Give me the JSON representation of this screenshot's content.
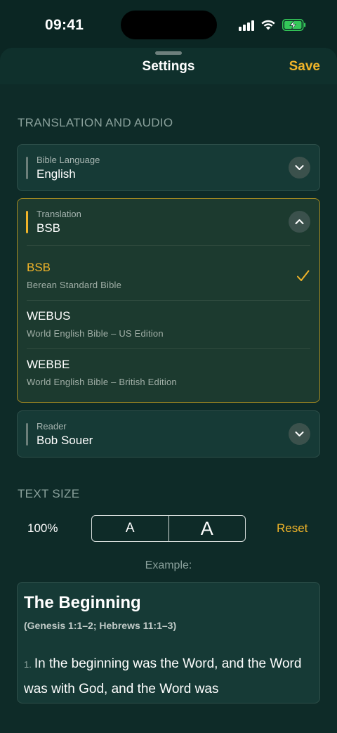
{
  "status": {
    "time": "09:41"
  },
  "header": {
    "title": "Settings",
    "save_label": "Save"
  },
  "sections": {
    "translation_audio": "TRANSLATION AND AUDIO",
    "text_size": "TEXT SIZE"
  },
  "bible_language": {
    "label": "Bible Language",
    "value": "English"
  },
  "translation": {
    "label": "Translation",
    "value": "BSB",
    "options": [
      {
        "code": "BSB",
        "name": "Berean Standard Bible",
        "selected": true
      },
      {
        "code": "WEBUS",
        "name": "World English Bible – US Edition",
        "selected": false
      },
      {
        "code": "WEBBE",
        "name": "World English Bible – British Edition",
        "selected": false
      }
    ]
  },
  "reader": {
    "label": "Reader",
    "value": "Bob Souer"
  },
  "text_size": {
    "percent": "100%",
    "small_label": "A",
    "large_label": "A",
    "reset_label": "Reset"
  },
  "example": {
    "label": "Example:",
    "title": "The Beginning",
    "reference": "(Genesis 1:1–2; Hebrews 11:1–3)",
    "verse_number": "1.",
    "verse_text": "In the beginning was the Word, and the Word was with God, and the Word was"
  },
  "colors": {
    "accent": "#f0b429",
    "background": "#0b2623",
    "card": "#163a36"
  },
  "icons": [
    "cellular-signal-icon",
    "wifi-icon",
    "battery-charging-icon",
    "chevron-down-icon",
    "chevron-up-icon",
    "checkmark-icon"
  ]
}
